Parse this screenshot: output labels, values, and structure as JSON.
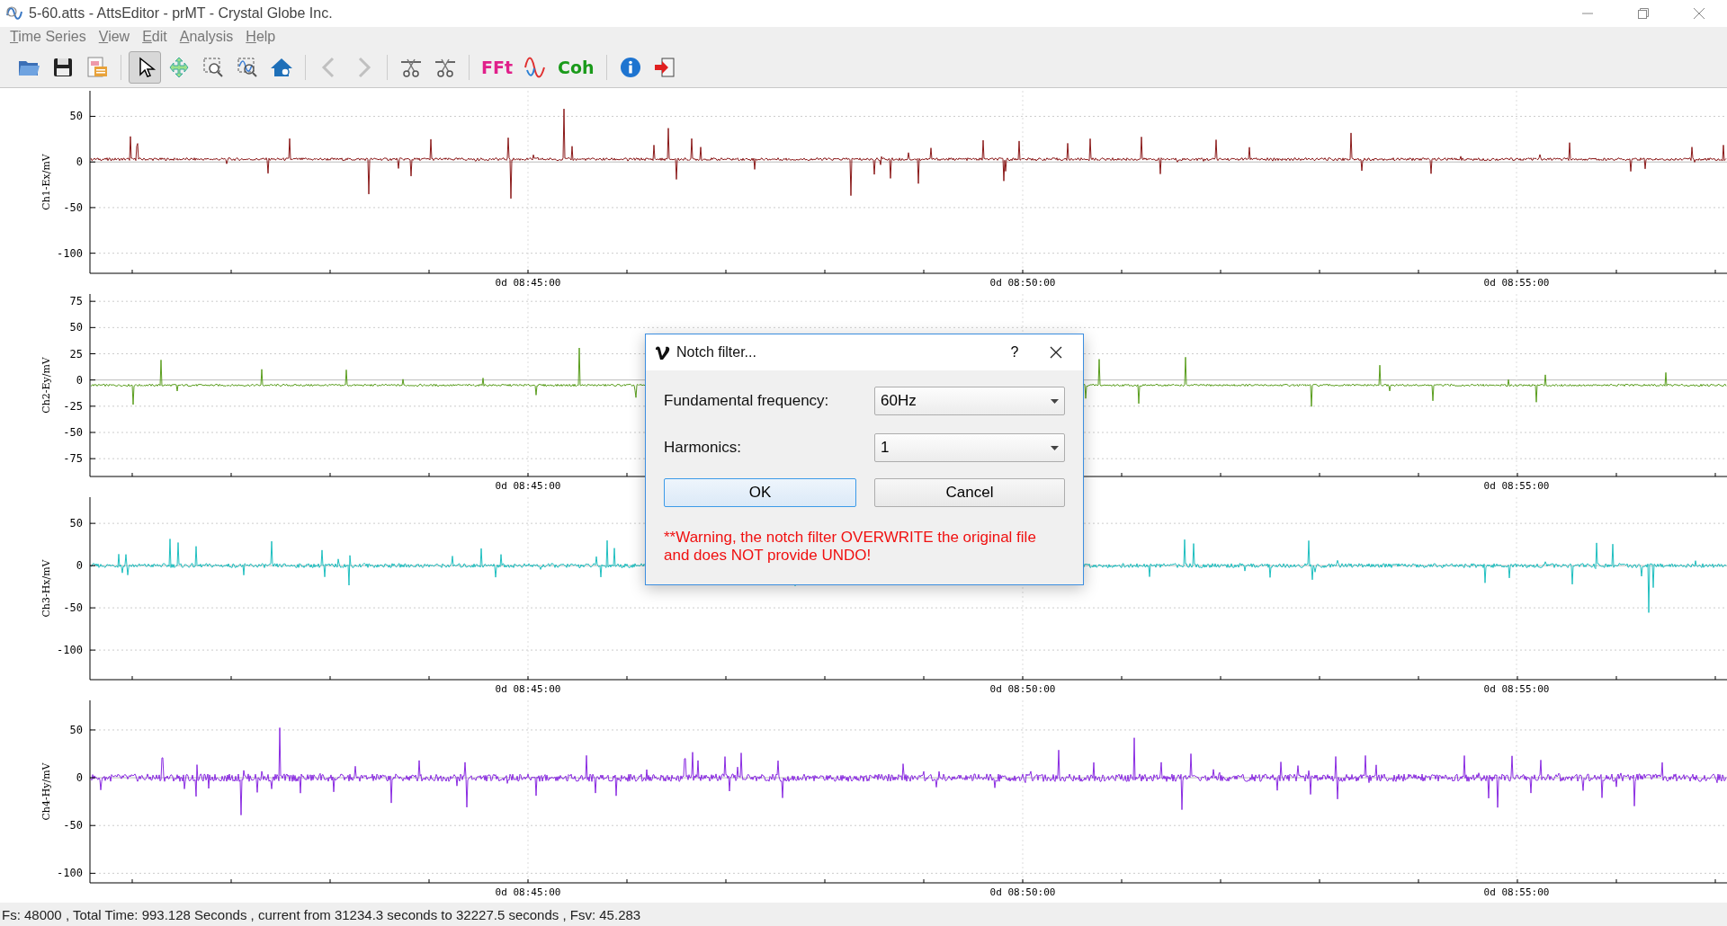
{
  "window": {
    "title": "5-60.atts - AttsEditor - prMT - Crystal Globe Inc."
  },
  "menu": [
    "Time Series",
    "View",
    "Edit",
    "Analysis",
    "Help"
  ],
  "toolbar": [
    [
      {
        "selected": false,
        "disabled": false
      },
      {
        "selected": false,
        "disabled": false
      },
      {
        "selected": false,
        "disabled": false
      }
    ],
    [
      {
        "selected": true,
        "disabled": false
      },
      {
        "selected": false,
        "disabled": false
      },
      {
        "selected": false,
        "disabled": false
      },
      {
        "selected": false,
        "disabled": false
      },
      {
        "selected": false,
        "disabled": false
      }
    ],
    [
      {
        "selected": false,
        "disabled": true
      },
      {
        "selected": false,
        "disabled": true
      }
    ],
    [
      {
        "selected": false,
        "disabled": false
      },
      {
        "selected": false,
        "disabled": false
      }
    ],
    [
      {
        "selected": false,
        "disabled": false,
        "label": "FFt"
      },
      {
        "selected": false,
        "disabled": false
      },
      {
        "selected": false,
        "disabled": false,
        "label": "Coh"
      }
    ],
    [
      {
        "selected": false,
        "disabled": false
      },
      {
        "selected": false,
        "disabled": false
      }
    ]
  ],
  "plots": [
    {
      "y_label": "Ch1-Ex/mV",
      "color": "#8b1a1a",
      "y_ticks": [
        "50",
        "0",
        "-50",
        "-100"
      ],
      "x_ticks": [
        "0d 08:45:00",
        "0d 08:50:00",
        "0d 08:55:00"
      ]
    },
    {
      "y_label": "Ch2-Ey/mV",
      "color": "#5a9e1e",
      "y_ticks": [
        "75",
        "50",
        "25",
        "0",
        "-25",
        "-50",
        "-75"
      ],
      "x_ticks": [
        "0d 08:45:00",
        "0d 08:55:00"
      ]
    },
    {
      "y_label": "Ch3-Hx/mV",
      "color": "#1ebfc0",
      "y_ticks": [
        "50",
        "0",
        "-50",
        "-100"
      ],
      "x_ticks": [
        "0d 08:45:00",
        "0d 08:50:00",
        "0d 08:55:00"
      ]
    },
    {
      "y_label": "Ch4-Hy/mV",
      "color": "#8a2be2",
      "y_ticks": [
        "50",
        "0",
        "-50",
        "-100"
      ],
      "x_ticks": [
        "0d 08:45:00",
        "0d 08:50:00",
        "0d 08:55:00"
      ]
    }
  ],
  "dialog": {
    "title": "Notch filter...",
    "help": "?",
    "fields": [
      {
        "label": "Fundamental frequency:",
        "value": "60Hz"
      },
      {
        "label": "Harmonics:",
        "value": "1"
      }
    ],
    "buttons": [
      {
        "label": "OK",
        "default": true
      },
      {
        "label": "Cancel",
        "default": false
      }
    ],
    "warning": "**Warning, the notch filter OVERWRITE the original file and does NOT provide UNDO!"
  },
  "status_bar": "Fs: 48000 , Total Time: 993.128 Seconds , current from 31234.3 seconds to 32227.5 seconds , Fsv: 45.283"
}
